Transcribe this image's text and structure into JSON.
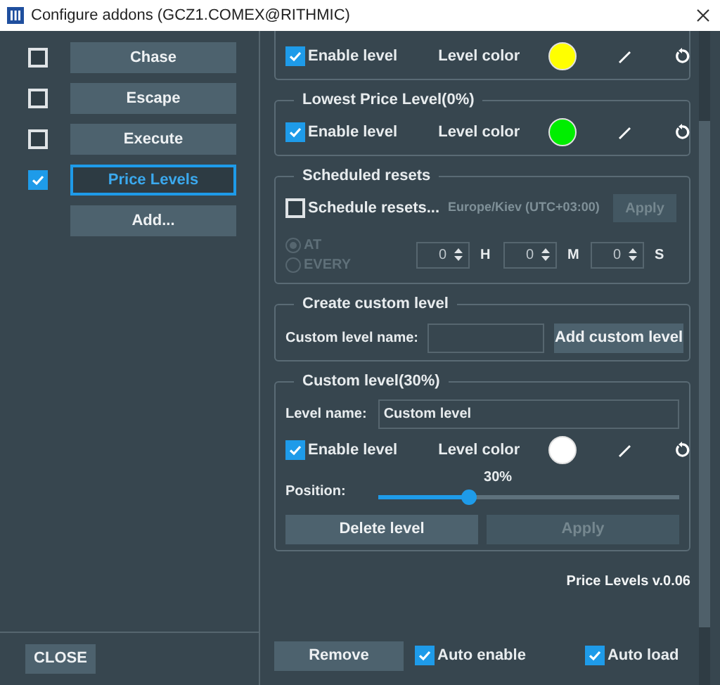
{
  "window": {
    "title": "Configure addons (GCZ1.COMEX@RITHMIC)"
  },
  "addons": [
    {
      "label": "Chase",
      "checked": false,
      "selected": false
    },
    {
      "label": "Escape",
      "checked": false,
      "selected": false
    },
    {
      "label": "Execute",
      "checked": false,
      "selected": false
    },
    {
      "label": "Price Levels",
      "checked": true,
      "selected": true
    }
  ],
  "add_button": "Add...",
  "close_button": "CLOSE",
  "level_groups": [
    {
      "enable_label": "Enable level",
      "enabled": true,
      "color_label": "Level color",
      "color": "#ffff00"
    },
    {
      "title": "Lowest Price Level(0%)",
      "enable_label": "Enable level",
      "enabled": true,
      "color_label": "Level color",
      "color": "#00ee00"
    }
  ],
  "scheduled": {
    "title": "Scheduled resets",
    "checkbox": {
      "label": "Schedule resets...",
      "checked": false
    },
    "timezone": "Europe/Kiev (UTC+03:00)",
    "apply": {
      "label": "Apply",
      "disabled": true
    },
    "modes": [
      {
        "label": "AT",
        "selected": true,
        "disabled": true
      },
      {
        "label": "EVERY",
        "selected": false,
        "disabled": true
      }
    ],
    "fields": [
      {
        "value": "0",
        "unit": "H"
      },
      {
        "value": "0",
        "unit": "M"
      },
      {
        "value": "0",
        "unit": "S"
      }
    ]
  },
  "create": {
    "title": "Create custom level",
    "label": "Custom level name:",
    "button": "Add custom level"
  },
  "custom": {
    "title": "Custom level(30%)",
    "name_label": "Level name:",
    "name_value": "Custom level",
    "enable_label": "Enable level",
    "enabled": true,
    "color_label": "Level color",
    "color": "#ffffff",
    "position_label": "Position:",
    "reading": "30%",
    "level": 0.3,
    "delete": "Delete level",
    "apply": {
      "label": "Apply",
      "disabled": true
    }
  },
  "version": "Price Levels v.0.06",
  "remove": "Remove",
  "auto_enable": {
    "label": "Auto enable",
    "checked": true
  },
  "auto_load": {
    "label": "Auto load",
    "checked": true
  }
}
